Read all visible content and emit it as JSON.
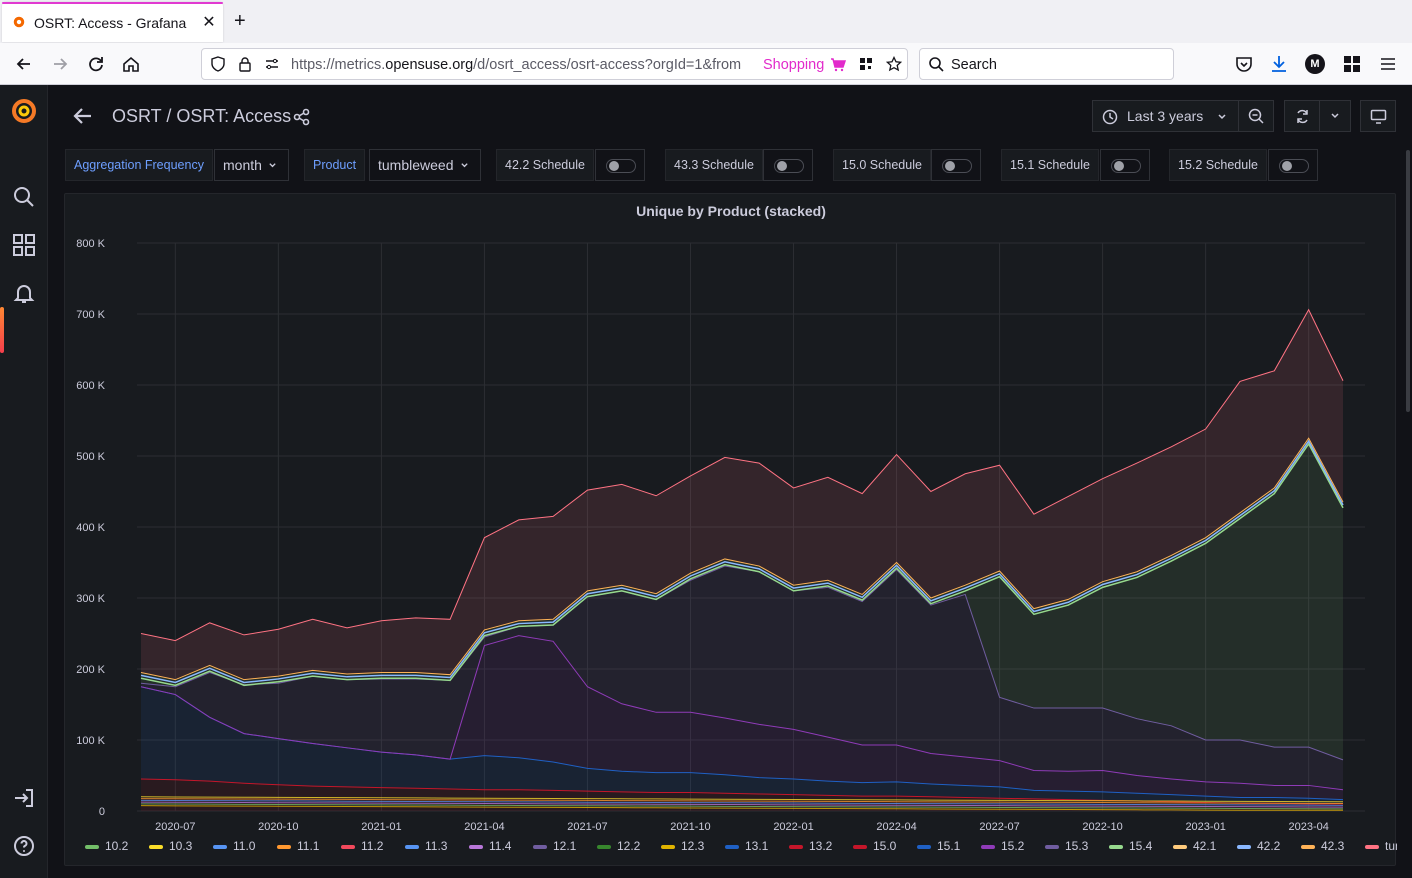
{
  "browser": {
    "tab_title": "OSRT: Access - Grafana",
    "tab_close": "✕",
    "new_tab": "+",
    "url_prefix": "https://metrics.",
    "url_domain": "opensuse.org",
    "url_rest": "/d/osrt_access/osrt-access?orgId=1&from",
    "shopping_label": "Shopping",
    "search_placeholder": "Search",
    "profile_initial": "M"
  },
  "breadcrumb": {
    "folder": "OSRT",
    "separator": "/",
    "dashboard": "OSRT: Access"
  },
  "toolbar": {
    "time_range": "Last 3 years"
  },
  "variables": {
    "aggregation_label": "Aggregation Frequency",
    "aggregation_value": "month",
    "product_label": "Product",
    "product_value": "tumbleweed",
    "schedules": [
      {
        "label": "42.2 Schedule",
        "enabled": false
      },
      {
        "label": "43.3 Schedule",
        "enabled": false
      },
      {
        "label": "15.0 Schedule",
        "enabled": false
      },
      {
        "label": "15.1 Schedule",
        "enabled": false
      },
      {
        "label": "15.2 Schedule",
        "enabled": false
      }
    ]
  },
  "chart_data": {
    "type": "area",
    "title": "Unique by Product (stacked)",
    "stacked": true,
    "ylim": [
      0,
      800000
    ],
    "yticks": [
      0,
      100000,
      200000,
      300000,
      400000,
      500000,
      600000,
      700000,
      800000
    ],
    "ytick_labels": [
      "0",
      "100 K",
      "200 K",
      "300 K",
      "400 K",
      "500 K",
      "600 K",
      "700 K",
      "800 K"
    ],
    "xtick_labels": [
      "2020-07",
      "2020-10",
      "2021-01",
      "2021-04",
      "2021-07",
      "2021-10",
      "2022-01",
      "2022-04",
      "2022-07",
      "2022-10",
      "2023-01",
      "2023-04"
    ],
    "x": [
      "2020-06",
      "2020-07",
      "2020-08",
      "2020-09",
      "2020-10",
      "2020-11",
      "2020-12",
      "2021-01",
      "2021-02",
      "2021-03",
      "2021-04",
      "2021-05",
      "2021-06",
      "2021-07",
      "2021-08",
      "2021-09",
      "2021-10",
      "2021-11",
      "2021-12",
      "2022-01",
      "2022-02",
      "2022-03",
      "2022-04",
      "2022-05",
      "2022-06",
      "2022-07",
      "2022-08",
      "2022-09",
      "2022-10",
      "2022-11",
      "2022-12",
      "2023-01",
      "2023-02",
      "2023-03",
      "2023-04",
      "2023-05"
    ],
    "grid": true,
    "legend_position": "bottom",
    "series": [
      {
        "name": "10.2",
        "color": "#73bf69"
      },
      {
        "name": "10.3",
        "color": "#fade2a"
      },
      {
        "name": "11.0",
        "color": "#5794f2"
      },
      {
        "name": "11.1",
        "color": "#ff9830"
      },
      {
        "name": "11.2",
        "color": "#f2495c"
      },
      {
        "name": "11.3",
        "color": "#5794f2"
      },
      {
        "name": "11.4",
        "color": "#b877d9"
      },
      {
        "name": "12.1",
        "color": "#705da0"
      },
      {
        "name": "12.2",
        "color": "#37872d"
      },
      {
        "name": "12.3",
        "color": "#e0b400"
      },
      {
        "name": "13.1",
        "color": "#1f60c4"
      },
      {
        "name": "13.2",
        "color": "#c4162a"
      },
      {
        "name": "15.0",
        "color": "#c4162a",
        "values": [
          45000,
          44000,
          42000,
          39000,
          37000,
          35000,
          34000,
          33000,
          32000,
          31000,
          30000,
          30000,
          29000,
          28000,
          27000,
          26000,
          26000,
          25000,
          24000,
          23000,
          22000,
          21000,
          21000,
          20000,
          19000,
          18000,
          17000,
          16000,
          15000,
          14000,
          13000,
          12000,
          11000,
          11000,
          10000,
          10000
        ]
      },
      {
        "name": "15.1",
        "color": "#1f60c4",
        "values": [
          130000,
          120000,
          90000,
          70000,
          65000,
          60000,
          55000,
          50000,
          47000,
          42000,
          48000,
          45000,
          40000,
          32000,
          29000,
          28000,
          28000,
          26000,
          23000,
          22000,
          20000,
          19000,
          20000,
          18000,
          17000,
          16000,
          12000,
          12000,
          12000,
          11000,
          10000,
          9000,
          8000,
          8000,
          8000,
          6000
        ]
      },
      {
        "name": "15.2",
        "color": "#8f3bb8",
        "values": [
          0,
          0,
          0,
          0,
          0,
          0,
          0,
          0,
          0,
          0,
          155000,
          172000,
          170000,
          115000,
          95000,
          85000,
          85000,
          80000,
          75000,
          70000,
          62000,
          53000,
          52000,
          43000,
          40000,
          37000,
          28000,
          28000,
          30000,
          25000,
          22000,
          20000,
          20000,
          17000,
          18000,
          14000
        ]
      },
      {
        "name": "15.3",
        "color": "#705da0",
        "values": [
          0,
          0,
          0,
          0,
          0,
          0,
          0,
          0,
          0,
          0,
          0,
          0,
          0,
          0,
          0,
          0,
          0,
          0,
          0,
          0,
          0,
          0,
          0,
          0,
          0,
          0,
          0,
          0,
          0,
          0,
          0,
          0,
          0,
          0,
          0,
          0
        ]
      },
      {
        "name": "15.4",
        "color": "#96d98d",
        "values": [
          0,
          0,
          0,
          0,
          0,
          0,
          0,
          0,
          0,
          0,
          0,
          0,
          0,
          0,
          0,
          0,
          0,
          0,
          0,
          0,
          0,
          0,
          0,
          0,
          0,
          0,
          0,
          0,
          0,
          0,
          0,
          0,
          0,
          0,
          0,
          0
        ]
      },
      {
        "name": "42.1",
        "color": "#ffcb7d"
      },
      {
        "name": "42.2",
        "color": "#8ab8ff"
      },
      {
        "name": "42.3",
        "color": "#ffb357"
      },
      {
        "name": "tumbleweed",
        "color": "#ff7383"
      }
    ],
    "totals": [
      250000,
      240000,
      265000,
      248000,
      256000,
      270000,
      258000,
      268000,
      272000,
      270000,
      385000,
      410000,
      415000,
      452000,
      460000,
      444000,
      472000,
      498000,
      490000,
      455000,
      470000,
      447000,
      502000,
      450000,
      475000,
      487000,
      418000,
      443000,
      468000,
      490000,
      513000,
      538000,
      605000,
      620000,
      706000,
      606000
    ],
    "leap_stack": [
      195000,
      185000,
      205000,
      185000,
      190000,
      198000,
      193000,
      195000,
      195000,
      192000,
      255000,
      268000,
      270000,
      310000,
      318000,
      306000,
      335000,
      355000,
      345000,
      318000,
      325000,
      305000,
      350000,
      300000,
      318000,
      338000,
      285000,
      298000,
      323000,
      337000,
      360000,
      385000,
      420000,
      455000,
      525000,
      435000
    ],
    "leap_base": [
      180000,
      175000,
      195000,
      178000,
      180000,
      190000,
      185000,
      186000,
      186000,
      184000,
      245000,
      260000,
      262000,
      302000,
      310000,
      298000,
      325000,
      345000,
      337000,
      310000,
      315000,
      295000,
      340000,
      290000,
      305000,
      160000,
      145000,
      145000,
      145000,
      130000,
      120000,
      100000,
      100000,
      90000,
      90000,
      72000
    ]
  },
  "colors": {
    "bg": "#111217",
    "panel": "#181b1f",
    "accent_orange": "#ff8833",
    "text": "#ccccdc"
  }
}
